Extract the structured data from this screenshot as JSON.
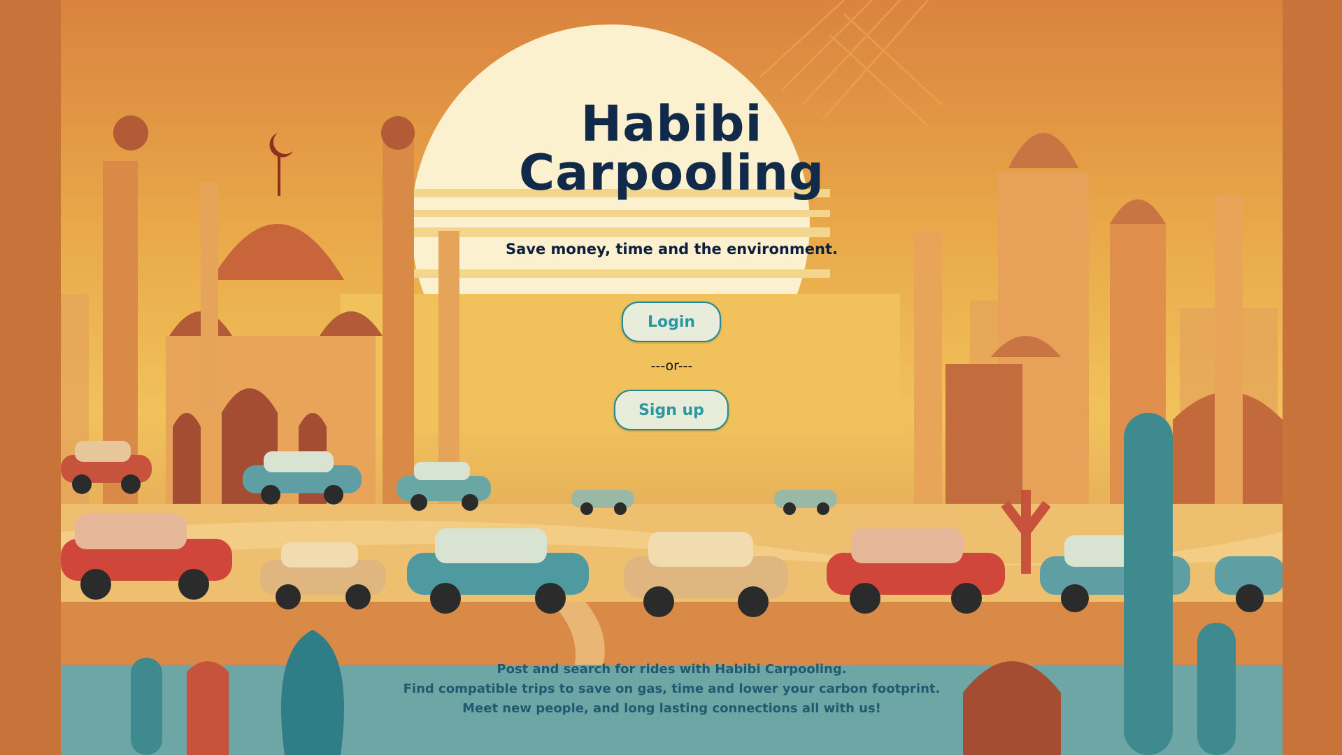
{
  "app": {
    "title_line1": "Habibi",
    "title_line2": "Carpooling",
    "tagline": "Save money, time and the environment."
  },
  "actions": {
    "login_label": "Login",
    "separator": "---or---",
    "signup_label": "Sign up"
  },
  "footer": {
    "lines": [
      "Post and search for rides with Habibi Carpooling.",
      "Find compatible trips to save on gas, time and lower your carbon footprint.",
      "Meet new people, and long lasting connections all with us!"
    ]
  },
  "colors": {
    "page_background": "#c8733a",
    "title": "#122a4a",
    "button_text": "#2a97a3",
    "button_border": "#1f8a91",
    "button_bg": "#e8ecda"
  }
}
